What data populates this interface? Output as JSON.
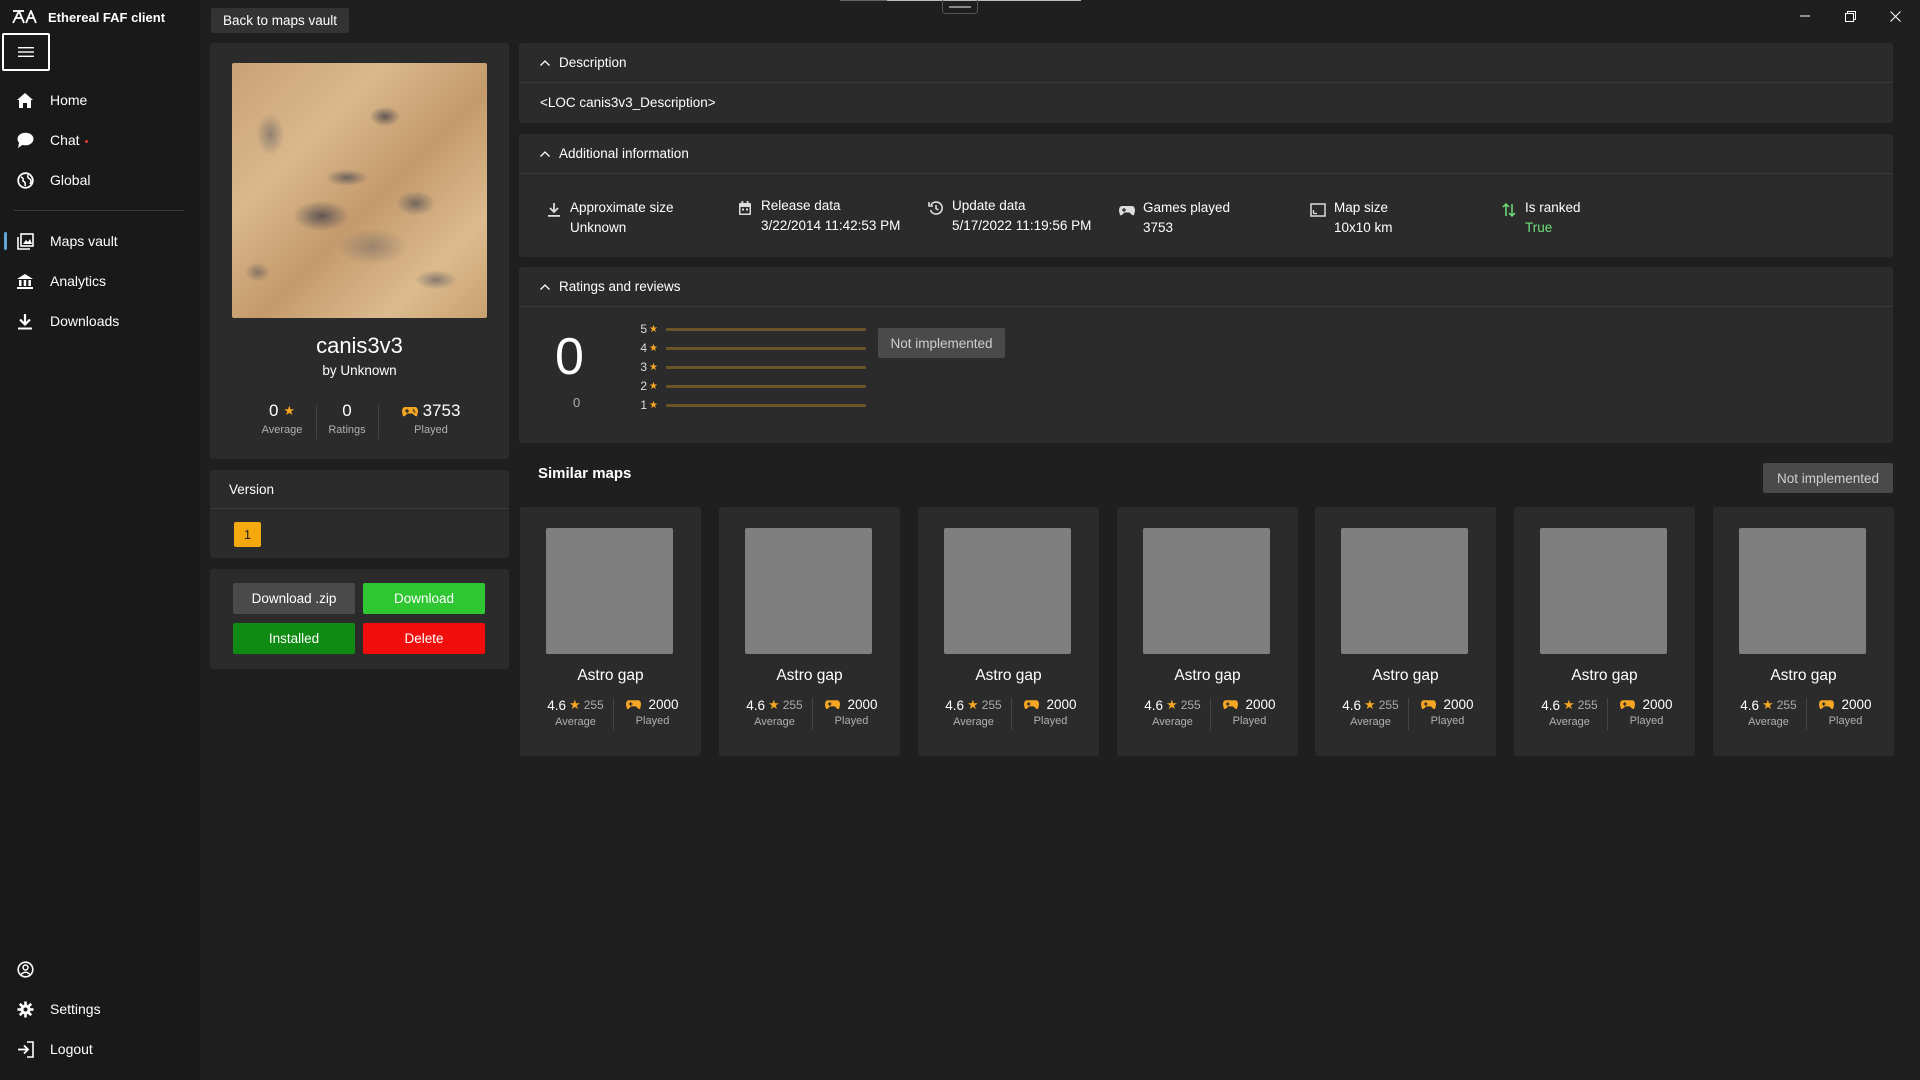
{
  "app": {
    "title": "Ethereal FAF client",
    "window_controls": {
      "minimize": "—",
      "restore": "❐",
      "close": "✕"
    }
  },
  "nav": {
    "items": [
      {
        "label": "Home",
        "icon": "home-icon"
      },
      {
        "label": "Chat",
        "icon": "chat-icon"
      },
      {
        "label": "Global",
        "icon": "globe-icon"
      },
      {
        "label": "Maps vault",
        "icon": "maps-vault-icon"
      },
      {
        "label": "Analytics",
        "icon": "analytics-icon"
      },
      {
        "label": "Downloads",
        "icon": "download-icon"
      }
    ],
    "bottom": [
      {
        "label": "",
        "icon": "user-icon"
      },
      {
        "label": "Settings",
        "icon": "gear-icon"
      },
      {
        "label": "Logout",
        "icon": "logout-icon"
      }
    ]
  },
  "top": {
    "back_label": "Back to maps vault"
  },
  "map": {
    "name": "canis3v3",
    "author": "by Unknown",
    "rating": "0",
    "rating_label": "Average",
    "ratings": "0",
    "ratings_label": "Ratings",
    "played": "3753",
    "played_label": "Played"
  },
  "version": {
    "title": "Version",
    "value": "1"
  },
  "actions": {
    "download_zip": "Download .zip",
    "download": "Download",
    "installed": "Installed",
    "delete": "Delete"
  },
  "description": {
    "title": "Description",
    "text": "<LOC canis3v3_Description>"
  },
  "additional": {
    "title": "Additional information",
    "items": [
      {
        "label": "Approximate size",
        "value": "Unknown",
        "icon": "download-icon"
      },
      {
        "label": "Release data",
        "value": "3/22/2014 11:42:53 PM",
        "icon": "calendar-icon"
      },
      {
        "label": "Update data",
        "value": "5/17/2022 11:19:56 PM",
        "icon": "history-icon"
      },
      {
        "label": "Games played",
        "value": "3753",
        "icon": "gamepad-icon"
      },
      {
        "label": "Map size",
        "value": "10x10 km",
        "icon": "map-size-icon"
      },
      {
        "label": "Is ranked",
        "value": "True",
        "icon": "sort-arrows-icon"
      }
    ]
  },
  "ratings": {
    "title": "Ratings and reviews",
    "score": "0",
    "count": "0",
    "levels": [
      "5",
      "4",
      "3",
      "2",
      "1"
    ],
    "not_implemented": "Not implemented"
  },
  "similar": {
    "title": "Similar maps",
    "not_implemented": "Not implemented",
    "cards": [
      {
        "name": "Astro gap",
        "rating": "4.6",
        "count": "255",
        "rating_label": "Average",
        "played": "2000",
        "played_label": "Played"
      },
      {
        "name": "Astro gap",
        "rating": "4.6",
        "count": "255",
        "rating_label": "Average",
        "played": "2000",
        "played_label": "Played"
      },
      {
        "name": "Astro gap",
        "rating": "4.6",
        "count": "255",
        "rating_label": "Average",
        "played": "2000",
        "played_label": "Played"
      },
      {
        "name": "Astro gap",
        "rating": "4.6",
        "count": "255",
        "rating_label": "Average",
        "played": "2000",
        "played_label": "Played"
      },
      {
        "name": "Astro gap",
        "rating": "4.6",
        "count": "255",
        "rating_label": "Average",
        "played": "2000",
        "played_label": "Played"
      },
      {
        "name": "Astro gap",
        "rating": "4.6",
        "count": "255",
        "rating_label": "Average",
        "played": "2000",
        "played_label": "Played"
      },
      {
        "name": "Astro gap",
        "rating": "4.6",
        "count": "255",
        "rating_label": "Average",
        "played": "2000",
        "played_label": "Played"
      }
    ]
  },
  "colors": {
    "accent_star": "#f5a623",
    "download_green": "#2ec731",
    "installed_green": "#0f8a12",
    "delete_red": "#f20d0d",
    "ranked_true": "#6ee07a",
    "version_badge": "#f6a80f"
  }
}
